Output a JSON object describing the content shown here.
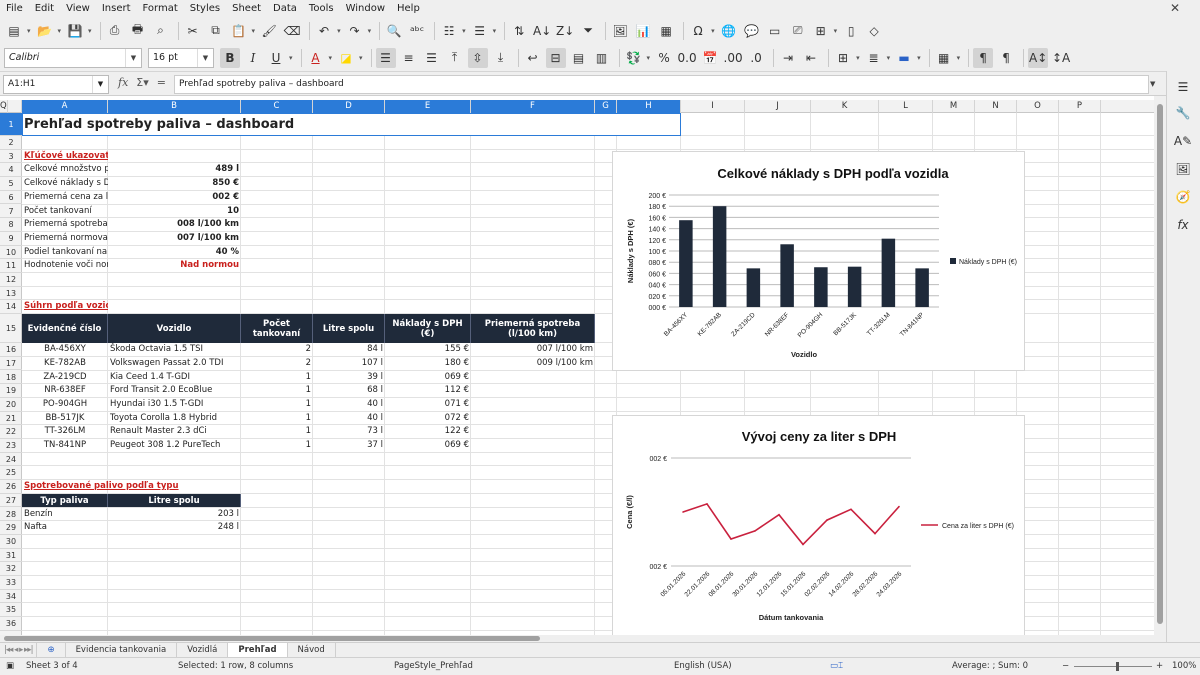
{
  "menubar": [
    "File",
    "Edit",
    "View",
    "Insert",
    "Format",
    "Styles",
    "Sheet",
    "Data",
    "Tools",
    "Window",
    "Help"
  ],
  "toolbar2": {
    "font_name": "Calibri",
    "font_size": "16 pt"
  },
  "formula_bar": {
    "name_box": "A1:H1",
    "content": "Prehľad spotreby paliva – dashboard"
  },
  "columns": [
    "A",
    "B",
    "C",
    "D",
    "E",
    "F",
    "G",
    "H",
    "I",
    "J",
    "K",
    "L",
    "M",
    "N",
    "O",
    "P",
    "Q"
  ],
  "rows": [
    "1",
    "2",
    "3",
    "4",
    "5",
    "6",
    "7",
    "8",
    "9",
    "10",
    "11",
    "12",
    "13",
    "14",
    "15",
    "16",
    "17",
    "18",
    "19",
    "20",
    "21",
    "22",
    "23",
    "24",
    "25",
    "26",
    "27",
    "28",
    "29",
    "30",
    "31",
    "32",
    "33",
    "34",
    "35",
    "36"
  ],
  "sheet": {
    "title": "Prehľad spotreby paliva – dashboard",
    "kpi_heading": "Kľúčové ukazovatele",
    "kpis": [
      {
        "label": "Celkové množstvo p",
        "value": "489 l",
        "red": false
      },
      {
        "label": "Celkové náklady s Dł",
        "value": "850 €",
        "red": false
      },
      {
        "label": "Priemerná cena za li",
        "value": "002 €",
        "red": false
      },
      {
        "label": "Počet tankovaní",
        "value": "10",
        "red": false
      },
      {
        "label": "Priemerná spotreba",
        "value": "008 l/100 km",
        "red": false
      },
      {
        "label": "Priemerná normova",
        "value": "007 l/100 km",
        "red": false
      },
      {
        "label": "Podiel tankovaní na",
        "value": "40 %",
        "red": false
      },
      {
        "label": "Hodnotenie voči nor",
        "value": "Nad normou",
        "red": true
      }
    ],
    "vehicle_heading": "Súhrn podľa vozidiel",
    "vehicle_headers": [
      "Evidenčné číslo",
      "Vozidlo",
      "Počet tankovaní",
      "Litre spolu",
      "Náklady s DPH (€)",
      "Priemerná spotreba (l/100 km)"
    ],
    "vehicles": [
      [
        "BA-456XY",
        "Škoda Octavia 1.5 TSI",
        "2",
        "84 l",
        "155 €",
        "007 l/100 km"
      ],
      [
        "KE-782AB",
        "Volkswagen Passat 2.0 TDI",
        "2",
        "107 l",
        "180 €",
        "009 l/100 km"
      ],
      [
        "ZA-219CD",
        "Kia Ceed 1.4 T-GDI",
        "1",
        "39 l",
        "069 €",
        ""
      ],
      [
        "NR-638EF",
        "Ford Transit 2.0 EcoBlue",
        "1",
        "68 l",
        "112 €",
        ""
      ],
      [
        "PO-904GH",
        "Hyundai i30 1.5 T-GDI",
        "1",
        "40 l",
        "071 €",
        ""
      ],
      [
        "BB-517JK",
        "Toyota Corolla 1.8 Hybrid",
        "1",
        "40 l",
        "072 €",
        ""
      ],
      [
        "TT-326LM",
        "Renault Master 2.3 dCi",
        "1",
        "73 l",
        "122 €",
        ""
      ],
      [
        "TN-841NP",
        "Peugeot 308 1.2 PureTech",
        "1",
        "37 l",
        "069 €",
        ""
      ]
    ],
    "fuel_heading": "Spotrebované palivo podľa typu",
    "fuel_headers": [
      "Typ paliva",
      "Litre spolu"
    ],
    "fuel": [
      [
        "Benzín",
        "203 l"
      ],
      [
        "Nafta",
        "248 l"
      ]
    ]
  },
  "chart_data": [
    {
      "type": "bar",
      "title": "Celkové náklady s DPH podľa vozidla",
      "xlabel": "Vozidlo",
      "ylabel": "Náklady s DPH (€)",
      "categories": [
        "BA-456XY",
        "KE-782AB",
        "ZA-219CD",
        "NR-638EF",
        "PO-904GH",
        "BB-517JK",
        "TT-326LM",
        "TN-841NP"
      ],
      "series": [
        {
          "name": "Náklady s DPH (€)",
          "values": [
            155,
            180,
            69,
            112,
            71,
            72,
            122,
            69
          ],
          "color": "#1f2a3a"
        }
      ],
      "yticks": [
        "000 €",
        "020 €",
        "040 €",
        "060 €",
        "080 €",
        "100 €",
        "120 €",
        "140 €",
        "160 €",
        "180 €",
        "200 €"
      ],
      "ylim": [
        0,
        200
      ],
      "grid": true,
      "legend": "right"
    },
    {
      "type": "line",
      "title": "Vývoj ceny za liter s DPH",
      "xlabel": "Dátum tankovania",
      "ylabel": "Cena (€/l)",
      "categories": [
        "05.01.2026",
        "22.01.2026",
        "08.01.2026",
        "30.01.2026",
        "12.01.2026",
        "15.01.2026",
        "02.02.2026",
        "14.02.2026",
        "28.02.2026",
        "24.03.2026"
      ],
      "series": [
        {
          "name": "Cena za liter s DPH (€)",
          "values": [
            1.7,
            1.73,
            1.6,
            1.63,
            1.69,
            1.58,
            1.67,
            1.71,
            1.62,
            1.72
          ],
          "color": "#c9213e"
        }
      ],
      "yticks": [
        "002 €",
        "002 €"
      ],
      "ylim": [
        1.5,
        1.9
      ],
      "grid": true,
      "legend": "right"
    }
  ],
  "sheet_tabs": [
    "Evidencia tankovania",
    "Vozidlá",
    "Prehľad",
    "Návod"
  ],
  "active_tab": "Prehľad",
  "status": {
    "sheet": "Sheet 3 of 4",
    "selection": "Selected: 1 row, 8 columns",
    "page_style": "PageStyle_Prehľad",
    "language": "English (USA)",
    "sum": "Average: ; Sum: 0",
    "zoom": "100%"
  }
}
